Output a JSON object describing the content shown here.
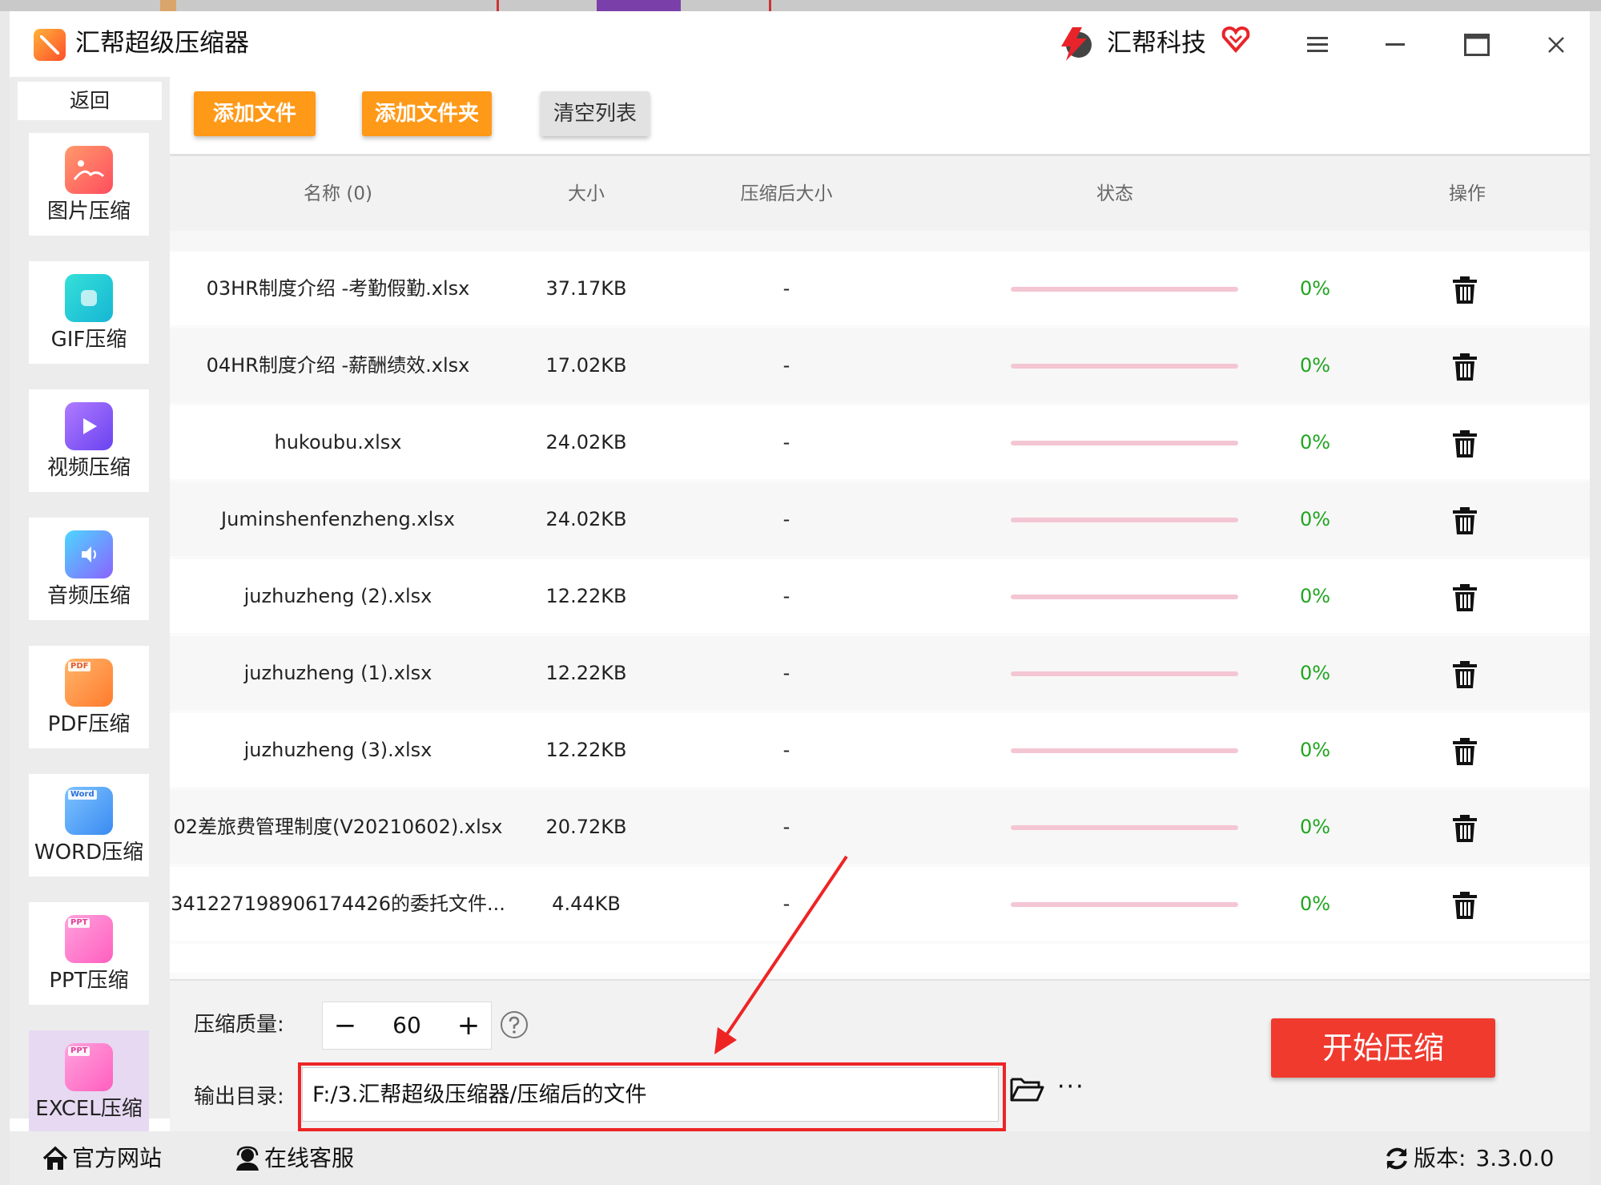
{
  "app": {
    "title": "汇帮超级压缩器",
    "brand_name": "汇帮科技"
  },
  "sidebar": {
    "back_label": "返回",
    "items": [
      {
        "label": "图片压缩",
        "icon": "image-icon"
      },
      {
        "label": "GIF压缩",
        "icon": "gif-icon"
      },
      {
        "label": "视频压缩",
        "icon": "video-play-icon"
      },
      {
        "label": "音频压缩",
        "icon": "audio-icon"
      },
      {
        "label": "PDF压缩",
        "icon": "pdf-file-icon",
        "tag": "PDF"
      },
      {
        "label": "WORD压缩",
        "icon": "word-file-icon",
        "tag": "Word"
      },
      {
        "label": "PPT压缩",
        "icon": "ppt-file-icon",
        "tag": "PPT"
      },
      {
        "label": "EXCEL压缩",
        "icon": "excel-file-icon",
        "tag": "PPT",
        "active": true
      }
    ]
  },
  "toolbar": {
    "add_file": "添加文件",
    "add_folder": "添加文件夹",
    "clear_list": "清空列表"
  },
  "table": {
    "headers": {
      "name": "名称 (0)",
      "size": "大小",
      "compressed_size": "压缩后大小",
      "status": "状态",
      "action": "操作"
    },
    "rows": [
      {
        "name": "03HR制度介绍 -考勤假勤.xlsx",
        "size": "37.17KB",
        "compressed": "-",
        "progress": "0%"
      },
      {
        "name": "04HR制度介绍 -薪酬绩效.xlsx",
        "size": "17.02KB",
        "compressed": "-",
        "progress": "0%"
      },
      {
        "name": "hukoubu.xlsx",
        "size": "24.02KB",
        "compressed": "-",
        "progress": "0%"
      },
      {
        "name": "Juminshenfenzheng.xlsx",
        "size": "24.02KB",
        "compressed": "-",
        "progress": "0%"
      },
      {
        "name": "juzhuzheng (2).xlsx",
        "size": "12.22KB",
        "compressed": "-",
        "progress": "0%"
      },
      {
        "name": "juzhuzheng (1).xlsx",
        "size": "12.22KB",
        "compressed": "-",
        "progress": "0%"
      },
      {
        "name": "juzhuzheng (3).xlsx",
        "size": "12.22KB",
        "compressed": "-",
        "progress": "0%"
      },
      {
        "name": "02差旅费管理制度(V20210602).xlsx",
        "size": "20.72KB",
        "compressed": "-",
        "progress": "0%"
      },
      {
        "name": "341227198906174426的委托文件...",
        "size": "4.44KB",
        "compressed": "-",
        "progress": "0%"
      }
    ]
  },
  "settings": {
    "quality_label": "压缩质量:",
    "quality_value": "60",
    "minus": "−",
    "plus": "+",
    "output_label": "输出目录:",
    "output_path": "F:/3.汇帮超级压缩器/压缩后的文件",
    "more": "···",
    "start_button": "开始压缩"
  },
  "footer": {
    "website": "官方网站",
    "support": "在线客服",
    "version_label": "版本:",
    "version": "3.3.0.0"
  },
  "colors": {
    "accent_orange": "#ff9918",
    "start_red": "#f03a2e",
    "progress_pink": "#f4c6d3",
    "percent_green": "#1fa51f",
    "annotation_red": "#ee2424"
  }
}
